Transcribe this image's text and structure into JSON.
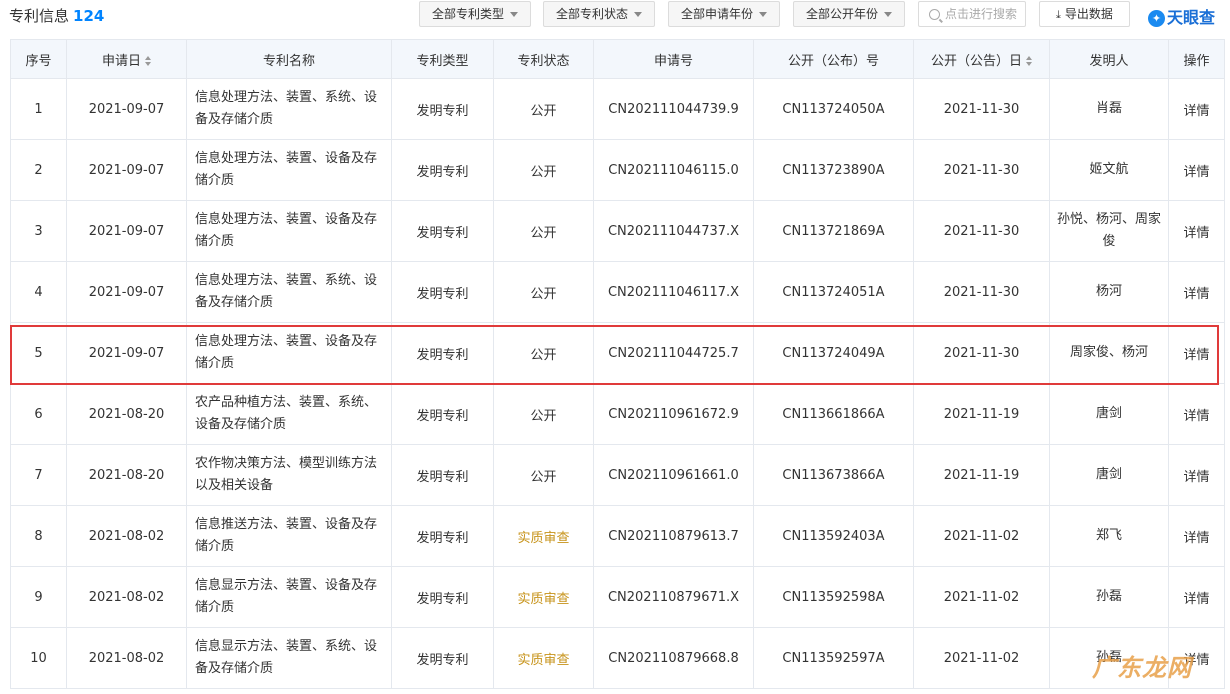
{
  "header": {
    "title": "专利信息",
    "count": "124",
    "filters": [
      "全部专利类型",
      "全部专利状态",
      "全部申请年份",
      "全部公开年份"
    ],
    "search_placeholder": "点击进行搜索",
    "export_label": "导出数据",
    "logo_text": "天眼查"
  },
  "table": {
    "columns": [
      "序号",
      "申请日",
      "专利名称",
      "专利类型",
      "专利状态",
      "申请号",
      "公开（公布）号",
      "公开（公告）日",
      "发明人",
      "操作"
    ],
    "rows": [
      {
        "no": "1",
        "apply_date": "2021-09-07",
        "name": "信息处理方法、装置、系统、设备及存储介质",
        "type": "发明专利",
        "status": "公开",
        "apply_no": "CN202111044739.9",
        "pub_no": "CN113724050A",
        "pub_date": "2021-11-30",
        "inventor": "肖磊",
        "action": "详情"
      },
      {
        "no": "2",
        "apply_date": "2021-09-07",
        "name": "信息处理方法、装置、设备及存储介质",
        "type": "发明专利",
        "status": "公开",
        "apply_no": "CN202111046115.0",
        "pub_no": "CN113723890A",
        "pub_date": "2021-11-30",
        "inventor": "姬文航",
        "action": "详情"
      },
      {
        "no": "3",
        "apply_date": "2021-09-07",
        "name": "信息处理方法、装置、设备及存储介质",
        "type": "发明专利",
        "status": "公开",
        "apply_no": "CN202111044737.X",
        "pub_no": "CN113721869A",
        "pub_date": "2021-11-30",
        "inventor": "孙悦、杨河、周家俊",
        "action": "详情"
      },
      {
        "no": "4",
        "apply_date": "2021-09-07",
        "name": "信息处理方法、装置、系统、设备及存储介质",
        "type": "发明专利",
        "status": "公开",
        "apply_no": "CN202111046117.X",
        "pub_no": "CN113724051A",
        "pub_date": "2021-11-30",
        "inventor": "杨河",
        "action": "详情"
      },
      {
        "no": "5",
        "apply_date": "2021-09-07",
        "name": "信息处理方法、装置、设备及存储介质",
        "type": "发明专利",
        "status": "公开",
        "apply_no": "CN202111044725.7",
        "pub_no": "CN113724049A",
        "pub_date": "2021-11-30",
        "inventor": "周家俊、杨河",
        "action": "详情"
      },
      {
        "no": "6",
        "apply_date": "2021-08-20",
        "name": "农产品种植方法、装置、系统、设备及存储介质",
        "type": "发明专利",
        "status": "公开",
        "apply_no": "CN202110961672.9",
        "pub_no": "CN113661866A",
        "pub_date": "2021-11-19",
        "inventor": "唐剑",
        "action": "详情"
      },
      {
        "no": "7",
        "apply_date": "2021-08-20",
        "name": "农作物决策方法、模型训练方法以及相关设备",
        "type": "发明专利",
        "status": "公开",
        "apply_no": "CN202110961661.0",
        "pub_no": "CN113673866A",
        "pub_date": "2021-11-19",
        "inventor": "唐剑",
        "action": "详情"
      },
      {
        "no": "8",
        "apply_date": "2021-08-02",
        "name": "信息推送方法、装置、设备及存储介质",
        "type": "发明专利",
        "status": "实质审查",
        "apply_no": "CN202110879613.7",
        "pub_no": "CN113592403A",
        "pub_date": "2021-11-02",
        "inventor": "郑飞",
        "action": "详情"
      },
      {
        "no": "9",
        "apply_date": "2021-08-02",
        "name": "信息显示方法、装置、设备及存储介质",
        "type": "发明专利",
        "status": "实质审查",
        "apply_no": "CN202110879671.X",
        "pub_no": "CN113592598A",
        "pub_date": "2021-11-02",
        "inventor": "孙磊",
        "action": "详情"
      },
      {
        "no": "10",
        "apply_date": "2021-08-02",
        "name": "信息显示方法、装置、系统、设备及存储介质",
        "type": "发明专利",
        "status": "实质审查",
        "apply_no": "CN202110879668.8",
        "pub_no": "CN113592597A",
        "pub_date": "2021-11-02",
        "inventor": "孙磊",
        "action": "详情"
      }
    ]
  },
  "watermark": "广东龙网"
}
